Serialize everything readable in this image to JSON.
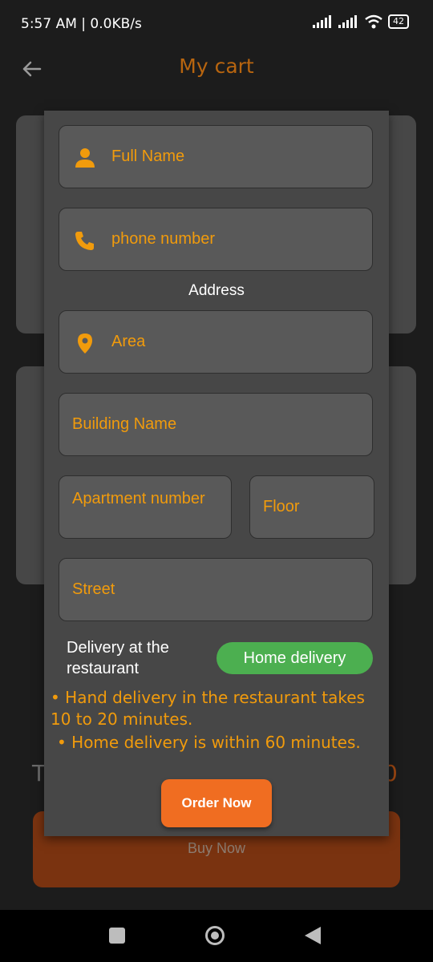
{
  "status_bar": {
    "time": "5:57 AM | 0.0KB/s",
    "battery": "42"
  },
  "app_bar": {
    "title": "My cart"
  },
  "background": {
    "total_left": "T",
    "total_right": "0",
    "buy_now_label": "Buy Now"
  },
  "form": {
    "full_name_placeholder": "Full Name",
    "phone_placeholder": "phone number",
    "address_heading": "Address",
    "area_placeholder": "Area",
    "building_placeholder": "Building Name",
    "apartment_placeholder": "Apartment number",
    "floor_placeholder": "Floor",
    "street_placeholder": "Street"
  },
  "delivery": {
    "restaurant_option": "Delivery at the restaurant",
    "home_option": "Home delivery"
  },
  "notes": {
    "note1": "• Hand delivery in the restaurant takes 10 to 20 minutes.",
    "note2": "• Home delivery is within 60 minutes."
  },
  "order_button_label": "Order Now",
  "colors": {
    "accent": "#f19b0c",
    "order_button": "#f06d21",
    "toggle_active": "#4caf50"
  }
}
